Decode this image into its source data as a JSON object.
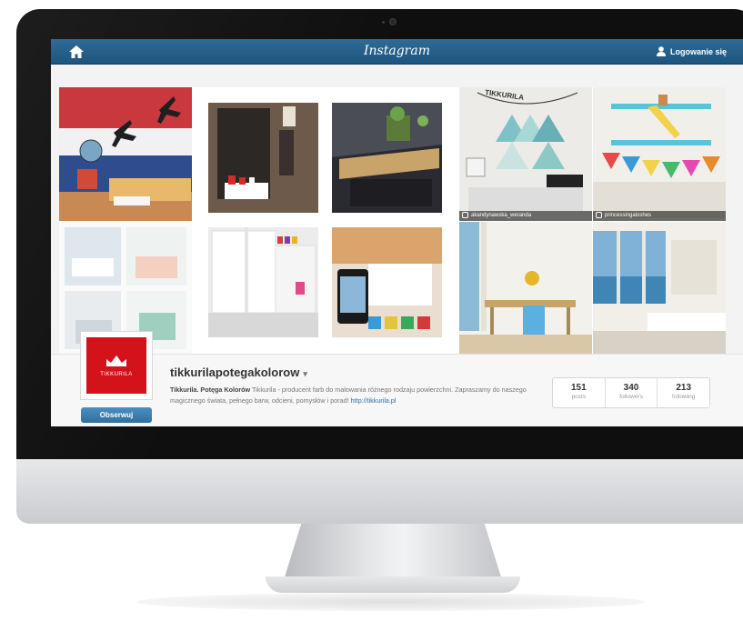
{
  "topbar": {
    "home_icon": "home-icon",
    "brand": "Instagram",
    "user_icon": "user-icon",
    "login_label": "Logowanie się"
  },
  "grid": {
    "credits": [
      "akandynawska_weranda",
      "princessingaloshes"
    ],
    "banner_text": "TIKKURILA"
  },
  "profile": {
    "logo_text": "TIKKURILA",
    "follow_label": "Obserwuj",
    "username": "tikkurilapotegakolorow",
    "username_chevron": "▾",
    "bio_bold": "Tikkurila. Potęga Kolorów",
    "bio_text": " Tikkurila - producent farb do malowania różnego rodzaju powierzchni. Zapraszamy do naszego magicznego świata, pełnego barw, odcieni, pomysłów i porad! ",
    "bio_link": "http://tikkurila.pl",
    "stats": [
      {
        "value": "151",
        "label": "posts"
      },
      {
        "value": "340",
        "label": "followers"
      },
      {
        "value": "213",
        "label": "following"
      }
    ]
  }
}
